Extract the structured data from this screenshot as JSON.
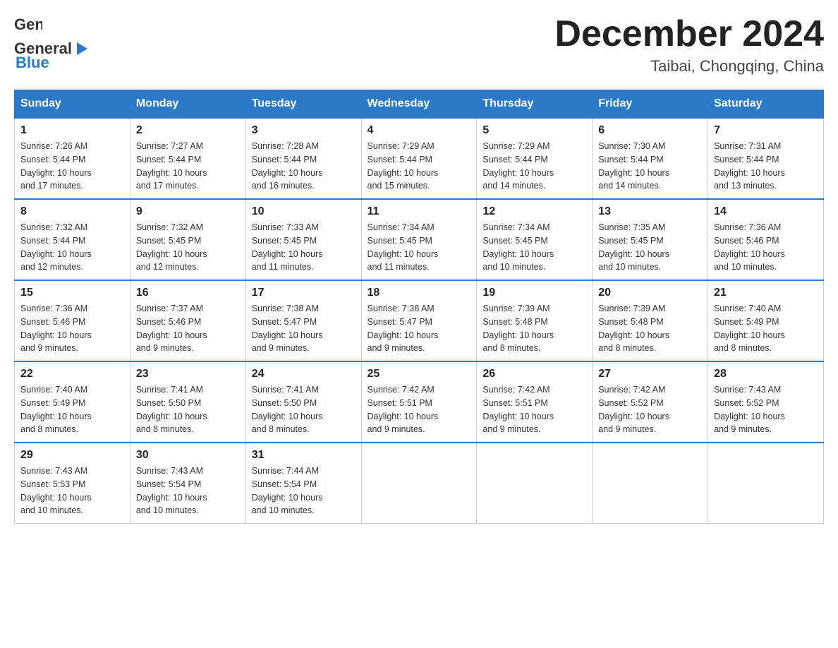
{
  "header": {
    "logo": {
      "general": "General",
      "blue": "Blue"
    },
    "title": "December 2024",
    "location": "Taibai, Chongqing, China"
  },
  "days_header": [
    "Sunday",
    "Monday",
    "Tuesday",
    "Wednesday",
    "Thursday",
    "Friday",
    "Saturday"
  ],
  "weeks": [
    [
      {
        "day": "1",
        "sunrise": "7:26 AM",
        "sunset": "5:44 PM",
        "daylight": "10 hours and 17 minutes."
      },
      {
        "day": "2",
        "sunrise": "7:27 AM",
        "sunset": "5:44 PM",
        "daylight": "10 hours and 17 minutes."
      },
      {
        "day": "3",
        "sunrise": "7:28 AM",
        "sunset": "5:44 PM",
        "daylight": "10 hours and 16 minutes."
      },
      {
        "day": "4",
        "sunrise": "7:29 AM",
        "sunset": "5:44 PM",
        "daylight": "10 hours and 15 minutes."
      },
      {
        "day": "5",
        "sunrise": "7:29 AM",
        "sunset": "5:44 PM",
        "daylight": "10 hours and 14 minutes."
      },
      {
        "day": "6",
        "sunrise": "7:30 AM",
        "sunset": "5:44 PM",
        "daylight": "10 hours and 14 minutes."
      },
      {
        "day": "7",
        "sunrise": "7:31 AM",
        "sunset": "5:44 PM",
        "daylight": "10 hours and 13 minutes."
      }
    ],
    [
      {
        "day": "8",
        "sunrise": "7:32 AM",
        "sunset": "5:44 PM",
        "daylight": "10 hours and 12 minutes."
      },
      {
        "day": "9",
        "sunrise": "7:32 AM",
        "sunset": "5:45 PM",
        "daylight": "10 hours and 12 minutes."
      },
      {
        "day": "10",
        "sunrise": "7:33 AM",
        "sunset": "5:45 PM",
        "daylight": "10 hours and 11 minutes."
      },
      {
        "day": "11",
        "sunrise": "7:34 AM",
        "sunset": "5:45 PM",
        "daylight": "10 hours and 11 minutes."
      },
      {
        "day": "12",
        "sunrise": "7:34 AM",
        "sunset": "5:45 PM",
        "daylight": "10 hours and 10 minutes."
      },
      {
        "day": "13",
        "sunrise": "7:35 AM",
        "sunset": "5:45 PM",
        "daylight": "10 hours and 10 minutes."
      },
      {
        "day": "14",
        "sunrise": "7:36 AM",
        "sunset": "5:46 PM",
        "daylight": "10 hours and 10 minutes."
      }
    ],
    [
      {
        "day": "15",
        "sunrise": "7:36 AM",
        "sunset": "5:46 PM",
        "daylight": "10 hours and 9 minutes."
      },
      {
        "day": "16",
        "sunrise": "7:37 AM",
        "sunset": "5:46 PM",
        "daylight": "10 hours and 9 minutes."
      },
      {
        "day": "17",
        "sunrise": "7:38 AM",
        "sunset": "5:47 PM",
        "daylight": "10 hours and 9 minutes."
      },
      {
        "day": "18",
        "sunrise": "7:38 AM",
        "sunset": "5:47 PM",
        "daylight": "10 hours and 9 minutes."
      },
      {
        "day": "19",
        "sunrise": "7:39 AM",
        "sunset": "5:48 PM",
        "daylight": "10 hours and 8 minutes."
      },
      {
        "day": "20",
        "sunrise": "7:39 AM",
        "sunset": "5:48 PM",
        "daylight": "10 hours and 8 minutes."
      },
      {
        "day": "21",
        "sunrise": "7:40 AM",
        "sunset": "5:49 PM",
        "daylight": "10 hours and 8 minutes."
      }
    ],
    [
      {
        "day": "22",
        "sunrise": "7:40 AM",
        "sunset": "5:49 PM",
        "daylight": "10 hours and 8 minutes."
      },
      {
        "day": "23",
        "sunrise": "7:41 AM",
        "sunset": "5:50 PM",
        "daylight": "10 hours and 8 minutes."
      },
      {
        "day": "24",
        "sunrise": "7:41 AM",
        "sunset": "5:50 PM",
        "daylight": "10 hours and 8 minutes."
      },
      {
        "day": "25",
        "sunrise": "7:42 AM",
        "sunset": "5:51 PM",
        "daylight": "10 hours and 9 minutes."
      },
      {
        "day": "26",
        "sunrise": "7:42 AM",
        "sunset": "5:51 PM",
        "daylight": "10 hours and 9 minutes."
      },
      {
        "day": "27",
        "sunrise": "7:42 AM",
        "sunset": "5:52 PM",
        "daylight": "10 hours and 9 minutes."
      },
      {
        "day": "28",
        "sunrise": "7:43 AM",
        "sunset": "5:52 PM",
        "daylight": "10 hours and 9 minutes."
      }
    ],
    [
      {
        "day": "29",
        "sunrise": "7:43 AM",
        "sunset": "5:53 PM",
        "daylight": "10 hours and 10 minutes."
      },
      {
        "day": "30",
        "sunrise": "7:43 AM",
        "sunset": "5:54 PM",
        "daylight": "10 hours and 10 minutes."
      },
      {
        "day": "31",
        "sunrise": "7:44 AM",
        "sunset": "5:54 PM",
        "daylight": "10 hours and 10 minutes."
      },
      null,
      null,
      null,
      null
    ]
  ],
  "labels": {
    "sunrise": "Sunrise:",
    "sunset": "Sunset:",
    "daylight": "Daylight:"
  }
}
